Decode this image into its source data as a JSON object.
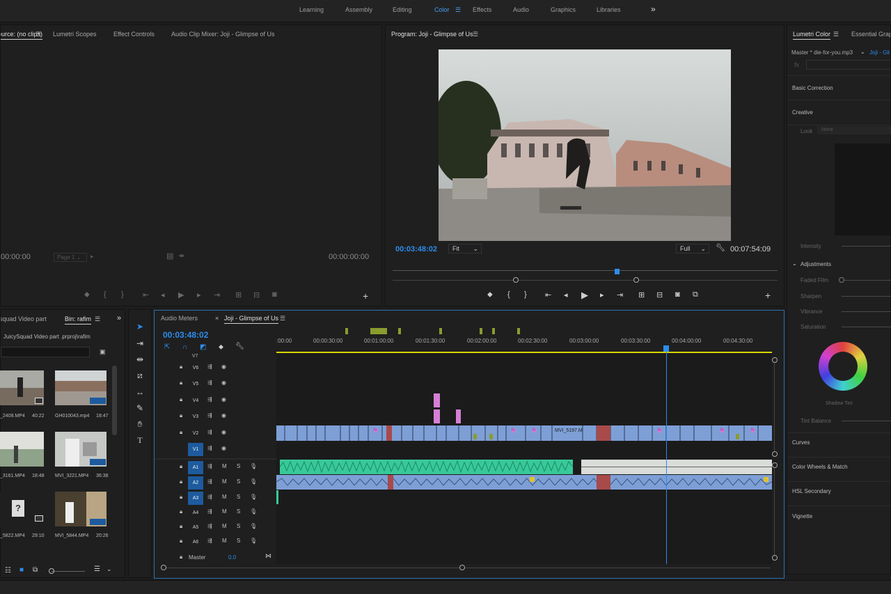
{
  "workspaces": [
    "Learning",
    "Assembly",
    "Editing",
    "Color",
    "Effects",
    "Audio",
    "Graphics",
    "Libraries"
  ],
  "active_workspace": "Color",
  "more_icon": "»",
  "source": {
    "tabs": [
      "Source: (no clips)",
      "Lumetri Scopes",
      "Effect Controls",
      "Audio Clip Mixer: Joji -  Glimpse of Us"
    ],
    "tc_left": "00:00:00",
    "tc_right": "00:00:00:00",
    "page": "Page 1"
  },
  "program": {
    "title": "Program: Joji -  Glimpse of Us",
    "tc_current": "00:03:48:02",
    "fit": "Fit",
    "quality": "Full",
    "tc_duration": "00:07:54:09"
  },
  "lumetri": {
    "tabs": [
      "Lumetri Color",
      "Essential Graphi"
    ],
    "master": "Master * die-for-you.mp3",
    "sequence": "Joji - Gli",
    "fx": "fx",
    "sections": {
      "basic": "Basic Correction",
      "creative": "Creative",
      "look": "Look",
      "look_value": "None",
      "intensity": "Intensity",
      "adjustments": "Adjustments",
      "faded_film": "Faded Film",
      "sharpen": "Sharpen",
      "vibrance": "Vibrance",
      "saturation": "Saturation",
      "shadow_tint": "Shadow Tint",
      "tint_balance": "Tint Balance",
      "curves": "Curves",
      "color_wheels": "Color Wheels & Match",
      "hsl": "HSL Secondary",
      "vignette": "Vignette"
    }
  },
  "project": {
    "tab_partial": "squad Video part",
    "tab_bin": "Bin: rafim",
    "path": "JuicySquad Video part .prproj\\rafim",
    "items": [
      {
        "name": "_2408.MP4",
        "len": "40:22"
      },
      {
        "name": "GH010043.mp4",
        "len": "18:47"
      },
      {
        "name": "_3161.MP4",
        "len": "18:48"
      },
      {
        "name": "MVI_3221.MP4",
        "len": "36:38"
      },
      {
        "name": "_5822.MP4",
        "len": "29:10"
      },
      {
        "name": "MVI_5844.MP4",
        "len": "20:26"
      }
    ]
  },
  "timeline": {
    "tabs": [
      "Audio Meters",
      "Joji -  Glimpse of Us"
    ],
    "timecode": "00:03:48:02",
    "ruler": [
      ":00:00",
      "00:00:30:00",
      "00:01:00:00",
      "00:01:30:00",
      "00:02:00:00",
      "00:02:30:00",
      "00:03:00:00",
      "00:03:30:00",
      "00:04:00:00",
      "00:04:30:00"
    ],
    "video_tracks": [
      "V7",
      "V6",
      "V5",
      "V4",
      "V3",
      "V2",
      "V1"
    ],
    "audio_tracks": [
      "A1",
      "A2",
      "A3",
      "A4",
      "A5",
      "A6"
    ],
    "master_label": "Master",
    "master_value": "0.0",
    "clip_label": "MVI_5197.M",
    "mute": "M",
    "solo": "S",
    "fx_label": "fx"
  },
  "colors": {
    "accent": "#2d8ceb",
    "video_clip": "#7d9fd6",
    "audio_clip": "#38c99a",
    "pink": "#d67fd6",
    "playhead": "#2d8ceb",
    "yellow_bar": "#d6d600"
  }
}
